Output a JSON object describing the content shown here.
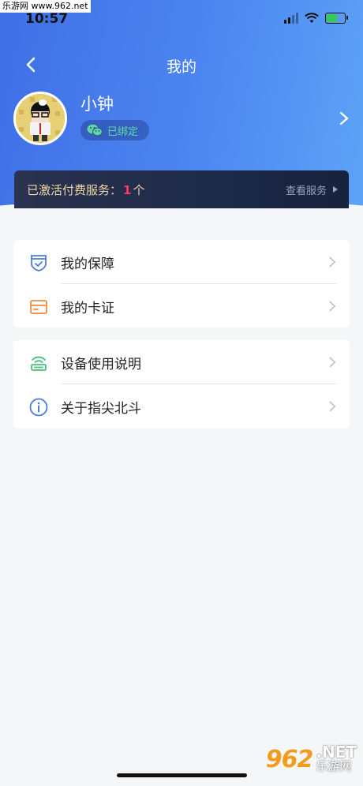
{
  "watermark": {
    "top": "乐游网 www.962.net",
    "logo": "962",
    "net": ".NET",
    "cn": "乐游网"
  },
  "status_bar": {
    "time": "10:57",
    "battery_level": 0.7
  },
  "nav": {
    "title": "我的"
  },
  "profile": {
    "name": "小钟",
    "wechat_status": "已绑定"
  },
  "service": {
    "label": "已激活付费服务：",
    "count": "1",
    "unit": "个",
    "link": "查看服务"
  },
  "menu_groups": [
    {
      "items": [
        {
          "label": "我的保障",
          "icon": "shield-check-icon"
        },
        {
          "label": "我的卡证",
          "icon": "card-icon"
        }
      ]
    },
    {
      "items": [
        {
          "label": "设备使用说明",
          "icon": "device-icon"
        },
        {
          "label": "关于指尖北斗",
          "icon": "info-icon"
        }
      ]
    }
  ],
  "colors": {
    "header_start": "#3f6fe6",
    "header_end": "#5ea3f7",
    "wechat_green": "#5fd6a7",
    "count_red": "#ff3c5a"
  }
}
